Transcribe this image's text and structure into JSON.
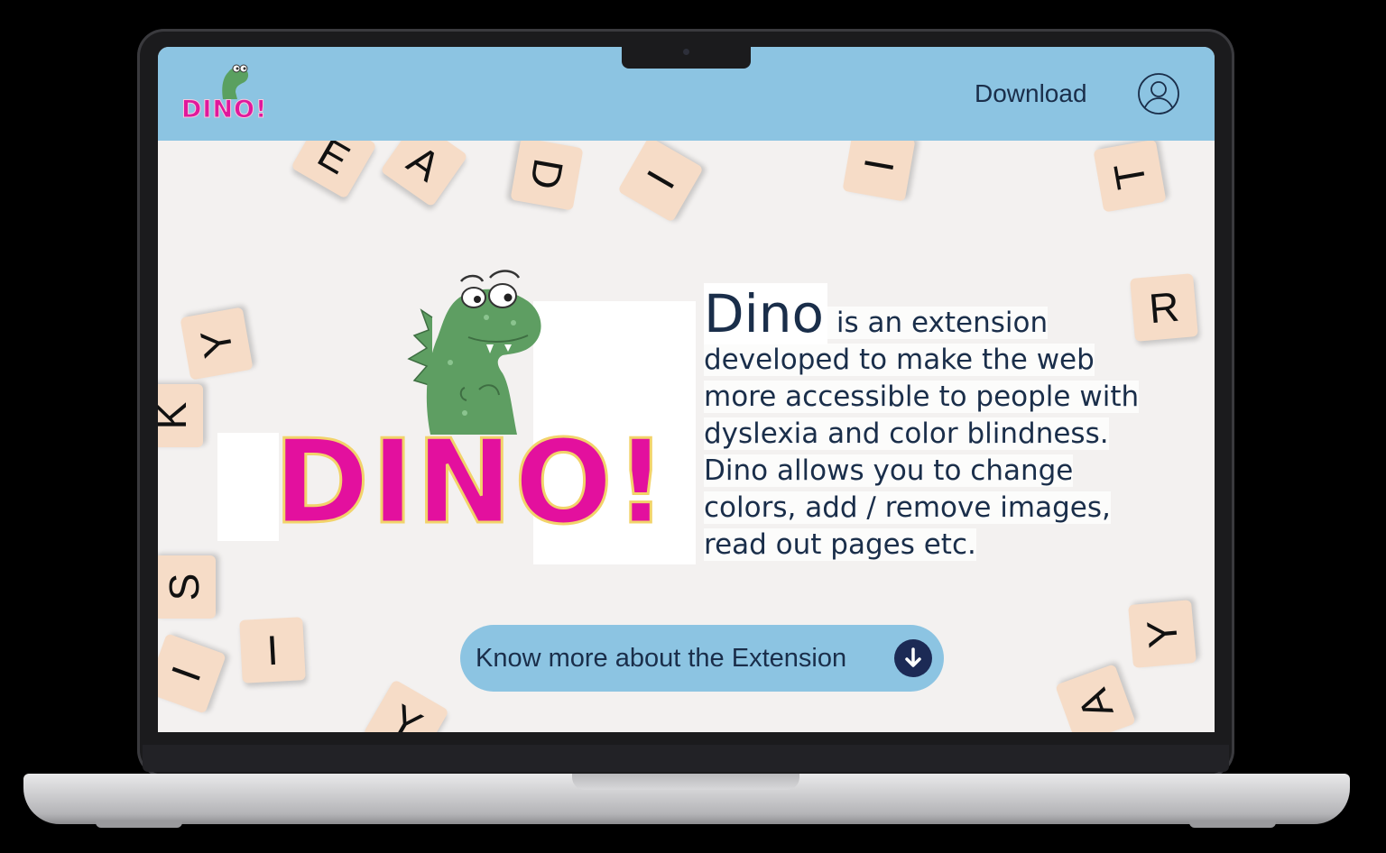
{
  "header": {
    "logo_text": "DINO!",
    "nav": {
      "download_label": "Download"
    },
    "user_icon": "user-circle-icon"
  },
  "hero": {
    "big_logo_text": "DINO!",
    "description": {
      "title": "Dino",
      "body": " is an extension developed to make the web more accessible to people with dyslexia and color blindness. Dino allows you to change colors, add / remove images, read out pages etc."
    },
    "cta": {
      "label": "Know more about the Extension",
      "icon": "arrow-down-circle-icon"
    },
    "tiles": [
      "D",
      "I",
      "I",
      "T",
      "R",
      "Y",
      "K",
      "Y",
      "S",
      "I",
      "I",
      "Y",
      "A",
      "E",
      "A"
    ]
  },
  "colors": {
    "header_bg": "#8cc4e2",
    "brand_pink": "#e3109e",
    "text_navy": "#1a2e4a",
    "tile": "#f6dcc7"
  }
}
